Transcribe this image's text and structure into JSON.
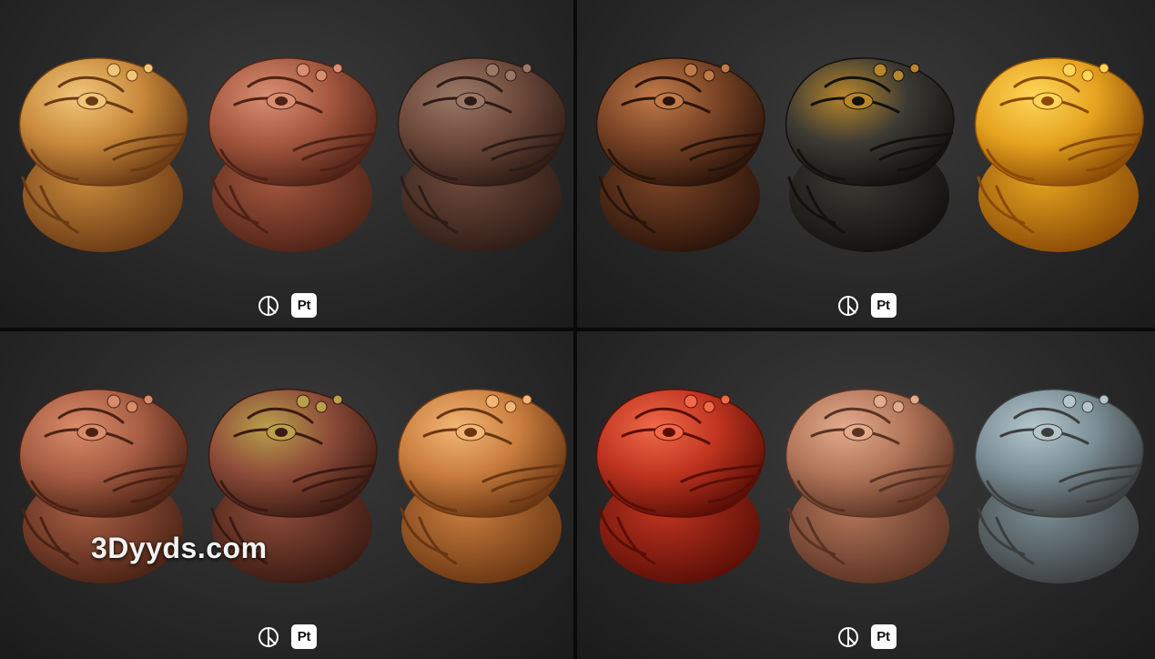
{
  "watermark": "3Dyyds.com",
  "logos": {
    "pt_label": "Pt"
  },
  "panels": [
    {
      "toads": [
        {
          "name": "toad-golden-wood",
          "fill": "#c98a3c",
          "dark": "#6a3a14",
          "light": "#f0c67a"
        },
        {
          "name": "toad-cherry-wood",
          "fill": "#a5583f",
          "dark": "#4e2216",
          "light": "#d98f74"
        },
        {
          "name": "toad-mossy-walnut",
          "fill": "#6e4a3c",
          "dark": "#2e1c16",
          "light": "#9a7866"
        }
      ]
    },
    {
      "toads": [
        {
          "name": "toad-dark-bronze",
          "fill": "#7a4426",
          "dark": "#2a140a",
          "light": "#c07a48"
        },
        {
          "name": "toad-black-gold",
          "fill": "#3c3a34",
          "dark": "#121110",
          "light": "#b8862a"
        },
        {
          "name": "toad-gold",
          "fill": "#e5a41f",
          "dark": "#8a4a06",
          "light": "#ffd65a"
        }
      ]
    },
    {
      "toads": [
        {
          "name": "toad-rosewood",
          "fill": "#a85e44",
          "dark": "#4a2214",
          "light": "#d98c6a"
        },
        {
          "name": "toad-mossy-rosewood",
          "fill": "#8e4c3a",
          "dark": "#3a1a12",
          "light": "#b9a04a"
        },
        {
          "name": "toad-light-oak",
          "fill": "#c97d3e",
          "dark": "#6a3612",
          "light": "#f2b676"
        }
      ]
    },
    {
      "toads": [
        {
          "name": "toad-red-lacquer",
          "fill": "#c03420",
          "dark": "#5a0e06",
          "light": "#f06a4a"
        },
        {
          "name": "toad-pale-rosewood",
          "fill": "#b2765a",
          "dark": "#5a3222",
          "light": "#e2ab8c"
        },
        {
          "name": "toad-weathered-teal",
          "fill": "#7a8e96",
          "dark": "#3c3e3e",
          "light": "#b4c6cc"
        }
      ]
    }
  ]
}
